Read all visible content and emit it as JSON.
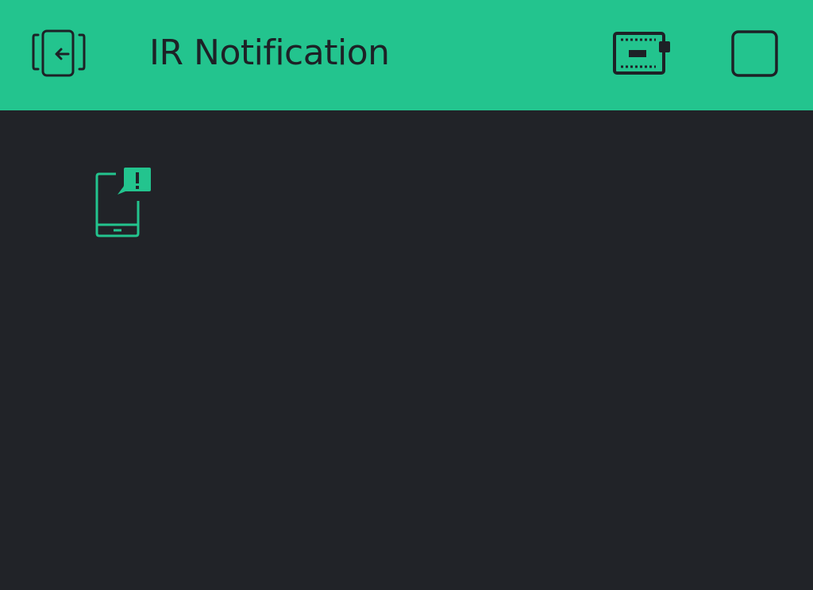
{
  "app": {
    "title": "IR Notification"
  },
  "header": {
    "back_icon": "exit-project-icon",
    "device_icon": "device-board-icon",
    "play_icon": "play-stop-icon"
  },
  "canvas": {
    "widgets": [
      {
        "name": "notification-widget",
        "icon": "phone-notification-icon"
      }
    ]
  },
  "colors": {
    "accent": "#23c48e",
    "background": "#212328",
    "header_text": "#1d2126"
  }
}
